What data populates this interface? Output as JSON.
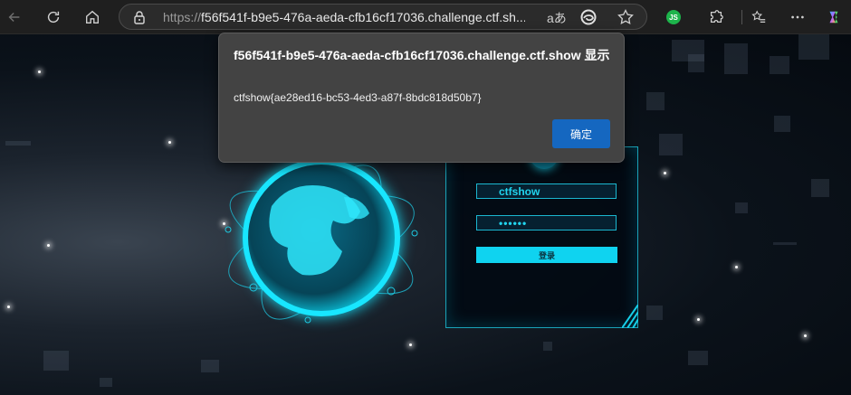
{
  "browser": {
    "url_scheme": "https://",
    "url_rest": "f56f541f-b9e5-476a-aeda-cfb16cf17036.challenge.ctf.sh...",
    "read_aloud_label": "aあ",
    "extension_badge": "JS"
  },
  "dialog": {
    "title": "f56f541f-b9e5-476a-aeda-cfb16cf17036.challenge.ctf.show 显示",
    "message": "ctfshow{ae28ed16-bc53-4ed3-a87f-8bdc818d50b7}",
    "ok_label": "确定"
  },
  "login": {
    "username_value": "ctfshow",
    "password_value": "••••••",
    "submit_label": "登录"
  },
  "colors": {
    "accent": "#0fd3f0",
    "dialog_bg": "#434343",
    "dialog_button": "#1567c0",
    "toolbar_bg": "#1f1f1f"
  }
}
